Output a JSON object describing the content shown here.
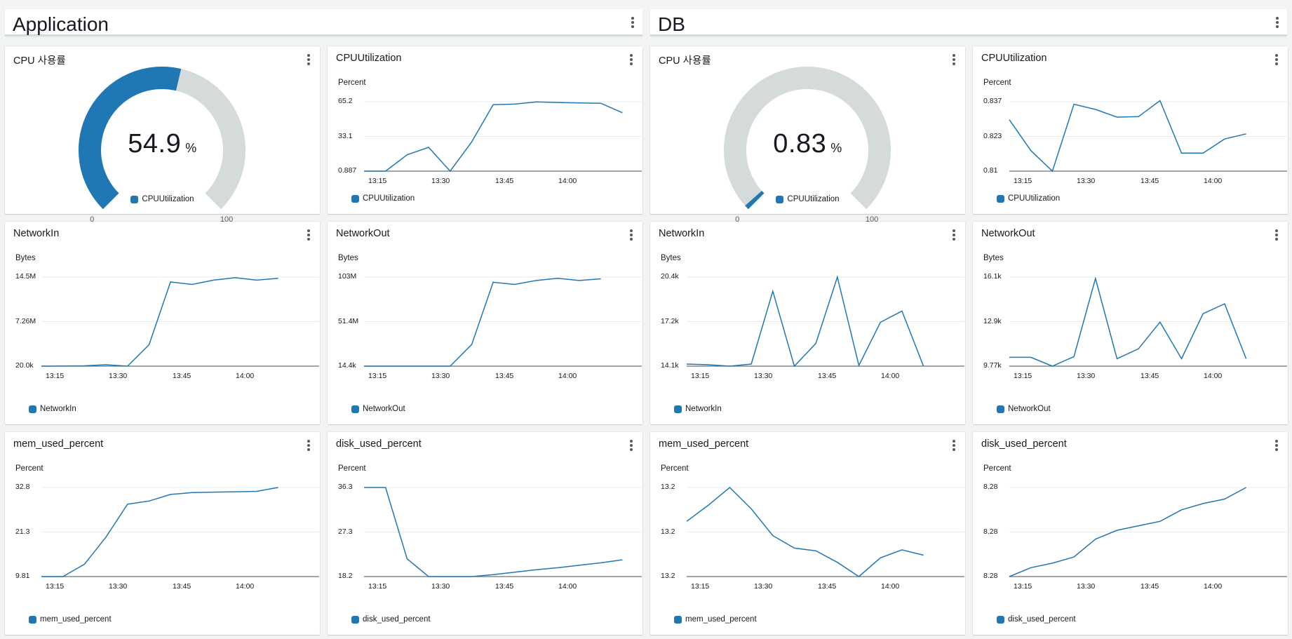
{
  "colors": {
    "series": "#1f77b4",
    "gauge_track": "#d5dbdb",
    "grid": "#e9ebed",
    "axis": "#687078"
  },
  "sections": [
    {
      "title": "Application",
      "menu_icon": "kebab-menu-icon"
    },
    {
      "title": "DB",
      "menu_icon": "kebab-menu-icon"
    }
  ],
  "x_tick_labels": [
    "13:15",
    "13:30",
    "13:45",
    "14:00"
  ],
  "widgets": [
    {
      "id": "app-cpu-gauge",
      "title": "CPU 사용률",
      "kind": "gauge",
      "value_text": "54.9",
      "unit": "%",
      "min_label": "0",
      "max_label": "100",
      "legend": "CPUUtilization",
      "value": 54.9
    },
    {
      "id": "app-cpu-line",
      "title": "CPUUtilization",
      "kind": "line",
      "unit_label": "Percent",
      "y_ticks": [
        "65.2",
        "33.1",
        "0.887"
      ],
      "legend": "CPUUtilization"
    },
    {
      "id": "db-cpu-gauge",
      "title": "CPU 사용률",
      "kind": "gauge",
      "value_text": "0.83",
      "unit": "%",
      "min_label": "0",
      "max_label": "100",
      "legend": "CPUUtilization",
      "value": 0.83
    },
    {
      "id": "db-cpu-line",
      "title": "CPUUtilization",
      "kind": "line",
      "unit_label": "Percent",
      "y_ticks": [
        "0.837",
        "0.823",
        "0.81"
      ],
      "legend": "CPUUtilization"
    },
    {
      "id": "app-network-in",
      "title": "NetworkIn",
      "kind": "line",
      "unit_label": "Bytes",
      "y_ticks": [
        "14.5M",
        "7.26M",
        "20.0k"
      ],
      "legend": "NetworkIn"
    },
    {
      "id": "app-network-out",
      "title": "NetworkOut",
      "kind": "line",
      "unit_label": "Bytes",
      "y_ticks": [
        "103M",
        "51.4M",
        "14.4k"
      ],
      "legend": "NetworkOut"
    },
    {
      "id": "db-network-in",
      "title": "NetworkIn",
      "kind": "line",
      "unit_label": "Bytes",
      "y_ticks": [
        "20.4k",
        "17.2k",
        "14.1k"
      ],
      "legend": "NetworkIn"
    },
    {
      "id": "db-network-out",
      "title": "NetworkOut",
      "kind": "line",
      "unit_label": "Bytes",
      "y_ticks": [
        "16.1k",
        "12.9k",
        "9.77k"
      ],
      "legend": "NetworkOut"
    },
    {
      "id": "app-mem",
      "title": "mem_used_percent",
      "kind": "line",
      "unit_label": "Percent",
      "y_ticks": [
        "32.8",
        "21.3",
        "9.81"
      ],
      "legend": "mem_used_percent"
    },
    {
      "id": "app-disk",
      "title": "disk_used_percent",
      "kind": "line",
      "unit_label": "Percent",
      "y_ticks": [
        "36.3",
        "27.3",
        "18.2"
      ],
      "legend": "disk_used_percent"
    },
    {
      "id": "db-mem",
      "title": "mem_used_percent",
      "kind": "line",
      "unit_label": "Percent",
      "y_ticks": [
        "13.2",
        "13.2",
        "13.2"
      ],
      "legend": "mem_used_percent"
    },
    {
      "id": "db-disk",
      "title": "disk_used_percent",
      "kind": "line",
      "unit_label": "Percent",
      "y_ticks": [
        "8.28",
        "8.28",
        "8.28"
      ],
      "legend": "disk_used_percent"
    }
  ],
  "chart_data": [
    {
      "type": "line",
      "title": "CPUUtilization",
      "ylabel": "Percent",
      "x": [
        "13:09",
        "13:12",
        "13:17",
        "13:22",
        "13:27",
        "13:31",
        "13:37",
        "13:42",
        "13:47",
        "13:52",
        "13:57",
        "14:02",
        "14:07"
      ],
      "ylim": [
        0.887,
        65.2
      ],
      "series": [
        {
          "name": "CPUUtilization",
          "values": [
            0.887,
            0.887,
            16,
            23,
            0.887,
            28,
            62.5,
            63,
            65,
            64.5,
            64,
            63.8,
            55
          ]
        }
      ]
    },
    {
      "type": "line",
      "title": "CPUUtilization",
      "ylabel": "Percent",
      "x": [
        "13:09",
        "13:12",
        "13:17",
        "13:22",
        "13:27",
        "13:31",
        "13:37",
        "13:42",
        "13:47",
        "13:52",
        "13:57",
        "14:02",
        "14:07"
      ],
      "ylim": [
        0.81,
        0.837
      ],
      "series": [
        {
          "name": "CPUUtilization",
          "values": [
            0.83,
            0.818,
            0.81,
            0.836,
            0.834,
            0.831,
            0.8312,
            0.8374,
            0.817,
            0.817,
            0.8225,
            0.8245
          ]
        }
      ]
    },
    {
      "type": "line",
      "title": "NetworkIn",
      "ylabel": "Bytes",
      "x": [
        "13:09",
        "13:12",
        "13:17",
        "13:22",
        "13:27",
        "13:31",
        "13:37",
        "13:42",
        "13:47",
        "13:52",
        "13:57",
        "14:02",
        "14:07"
      ],
      "ylim": [
        20000,
        14500000
      ],
      "series": [
        {
          "name": "NetworkIn",
          "values": [
            20000,
            30000,
            80000,
            250000,
            20000,
            3500000,
            13700000,
            13300000,
            14000000,
            14400000,
            14000000,
            14300000
          ]
        }
      ]
    },
    {
      "type": "line",
      "title": "NetworkOut",
      "ylabel": "Bytes",
      "x": [
        "13:09",
        "13:12",
        "13:17",
        "13:22",
        "13:27",
        "13:31",
        "13:37",
        "13:42",
        "13:47",
        "13:52",
        "13:57",
        "14:02",
        "14:07"
      ],
      "ylim": [
        14400,
        103000000
      ],
      "series": [
        {
          "name": "NetworkOut",
          "values": [
            14400,
            14400,
            14400,
            14400,
            14400,
            25000000,
            97000000,
            94500000,
            99000000,
            101500000,
            99000000,
            101000000
          ]
        }
      ]
    },
    {
      "type": "line",
      "title": "NetworkIn",
      "ylabel": "Bytes",
      "x": [
        "13:09",
        "13:12",
        "13:17",
        "13:22",
        "13:27",
        "13:31",
        "13:37",
        "13:42",
        "13:47",
        "13:52",
        "13:57",
        "14:02",
        "14:07"
      ],
      "ylim": [
        14100,
        20400
      ],
      "series": [
        {
          "name": "NetworkIn",
          "values": [
            14250,
            14200,
            14100,
            14250,
            19400,
            14100,
            15700,
            20400,
            14150,
            17200,
            18000,
            14100
          ]
        }
      ]
    },
    {
      "type": "line",
      "title": "NetworkOut",
      "ylabel": "Bytes",
      "x": [
        "13:09",
        "13:12",
        "13:17",
        "13:22",
        "13:27",
        "13:31",
        "13:37",
        "13:42",
        "13:47",
        "13:52",
        "13:57",
        "14:02",
        "14:07"
      ],
      "ylim": [
        9770,
        16100
      ],
      "series": [
        {
          "name": "NetworkOut",
          "values": [
            10400,
            10400,
            9770,
            10450,
            16000,
            10300,
            11000,
            12900,
            10300,
            13500,
            14200,
            10300
          ]
        }
      ]
    },
    {
      "type": "line",
      "title": "mem_used_percent",
      "ylabel": "Percent",
      "x": [
        "13:09",
        "13:12",
        "13:17",
        "13:22",
        "13:27",
        "13:31",
        "13:37",
        "13:42",
        "13:47",
        "13:52",
        "13:57",
        "14:02",
        "14:07"
      ],
      "ylim": [
        9.81,
        32.8
      ],
      "series": [
        {
          "name": "mem_used_percent",
          "values": [
            9.81,
            9.81,
            13,
            20,
            28.5,
            29.3,
            31,
            31.5,
            31.6,
            31.7,
            31.8,
            32.8
          ]
        }
      ]
    },
    {
      "type": "line",
      "title": "disk_used_percent",
      "ylabel": "Percent",
      "x": [
        "13:09",
        "13:12",
        "13:17",
        "13:22",
        "13:27",
        "13:31",
        "13:37",
        "13:42",
        "13:47",
        "13:52",
        "13:57",
        "14:02",
        "14:07"
      ],
      "ylim": [
        18.2,
        36.3
      ],
      "series": [
        {
          "name": "disk_used_percent",
          "values": [
            36.3,
            36.3,
            21.8,
            18.2,
            18.2,
            18.2,
            18.6,
            19.1,
            19.6,
            20.0,
            20.5,
            21.0,
            21.6
          ]
        }
      ]
    },
    {
      "type": "line",
      "title": "mem_used_percent",
      "ylabel": "Percent",
      "x": [
        "13:09",
        "13:12",
        "13:17",
        "13:22",
        "13:27",
        "13:31",
        "13:37",
        "13:42",
        "13:47",
        "13:52",
        "13:57",
        "14:02",
        "14:07"
      ],
      "series": [
        {
          "name": "mem_used_percent",
          "values": [
            0.62,
            0.8,
            1.0,
            0.76,
            0.46,
            0.32,
            0.29,
            0.16,
            0.0,
            0.21,
            0.3,
            0.24
          ]
        }
      ]
    },
    {
      "type": "line",
      "title": "disk_used_percent",
      "ylabel": "Percent",
      "x": [
        "13:09",
        "13:12",
        "13:17",
        "13:22",
        "13:27",
        "13:31",
        "13:37",
        "13:42",
        "13:47",
        "13:52",
        "13:57",
        "14:02",
        "14:07"
      ],
      "series": [
        {
          "name": "disk_used_percent",
          "values": [
            0.0,
            0.1,
            0.15,
            0.22,
            0.42,
            0.52,
            0.57,
            0.62,
            0.75,
            0.82,
            0.87,
            1.0
          ]
        }
      ]
    }
  ]
}
